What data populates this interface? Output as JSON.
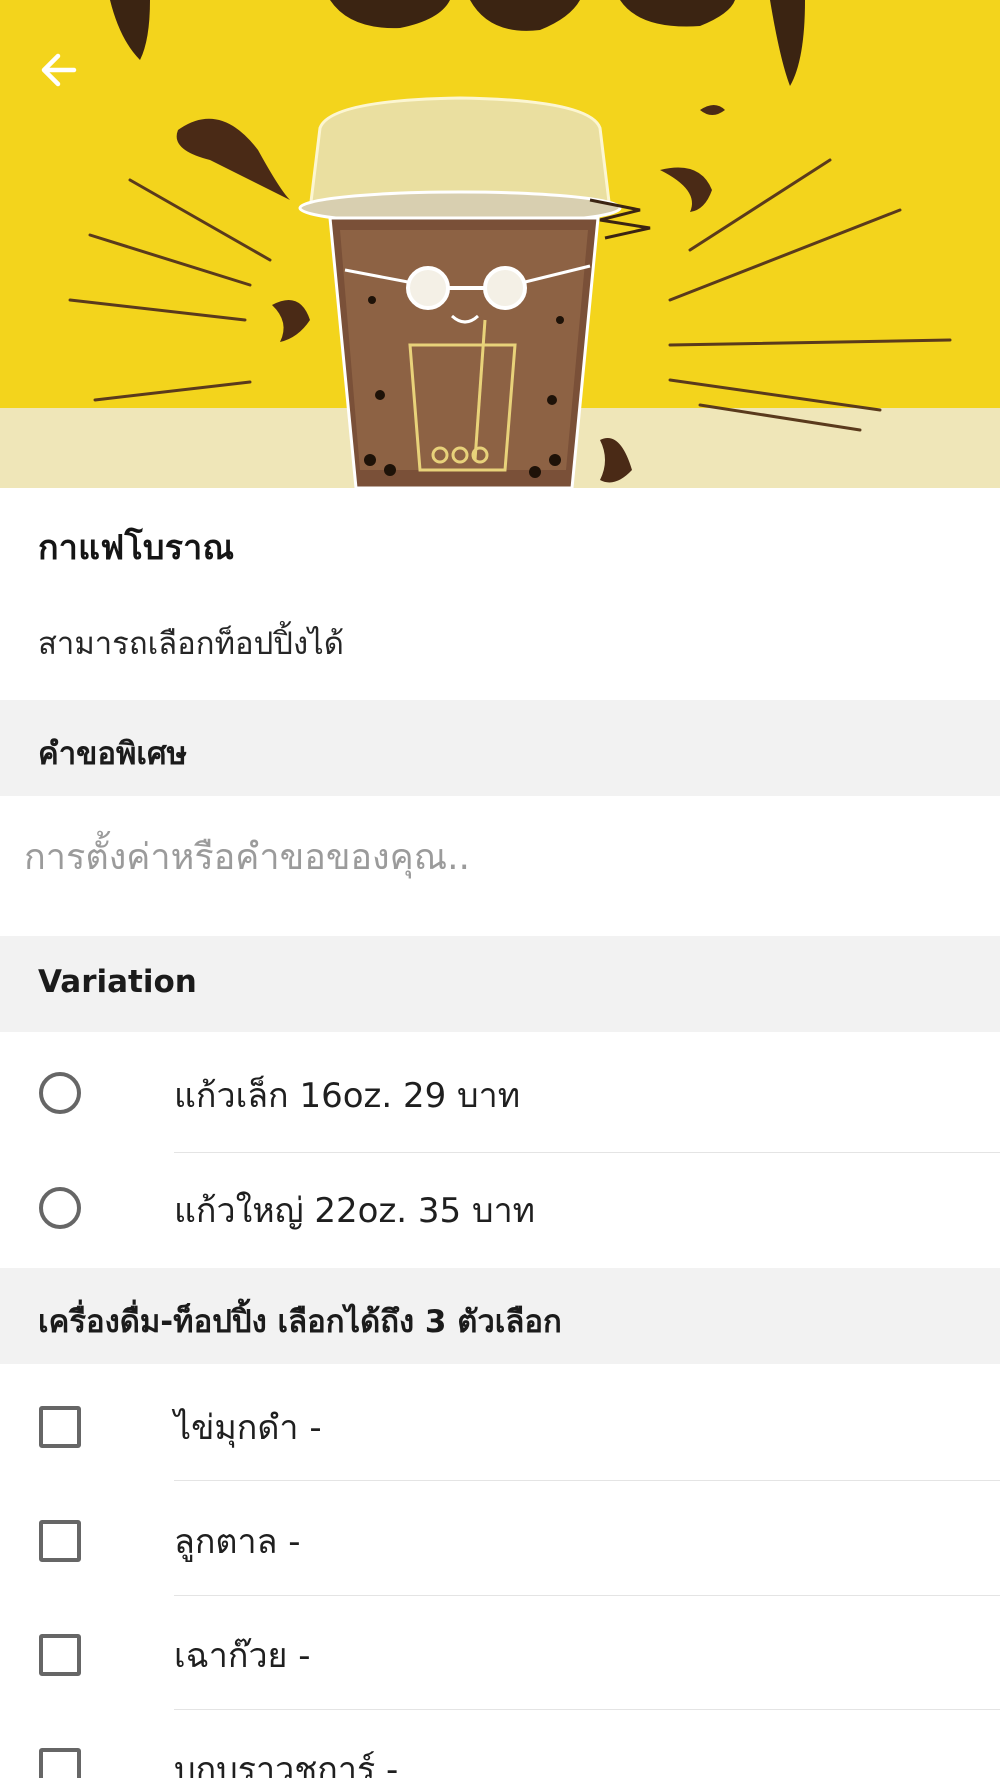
{
  "product": {
    "name": "กาแฟโบราณ",
    "description": "สามารถเลือกท็อปปิ้งได้"
  },
  "special_request": {
    "section_label": "คำขอพิเศษ",
    "placeholder": "การตั้งค่าหรือคำขอของคุณ.."
  },
  "variation": {
    "section_label": "Variation",
    "options": [
      {
        "label": "แก้วเล็ก 16oz. 29 บาท"
      },
      {
        "label": "แก้วใหญ่ 22oz. 35 บาท"
      }
    ]
  },
  "toppings": {
    "section_label": "เครื่องดื่ม-ท็อปปิ้ง เลือกได้ถึง 3 ตัวเลือก",
    "options": [
      {
        "label": "ไข่มุกดำ  -"
      },
      {
        "label": "ลูกตาล  -"
      },
      {
        "label": "เฉาก๊วย  -"
      },
      {
        "label": "บุกบราวชูการ์  -"
      }
    ]
  },
  "icons": {
    "back": "arrow-left-icon",
    "radio": "radio-unchecked-icon",
    "checkbox": "checkbox-unchecked-icon"
  },
  "colors": {
    "hero_background": "#f3d10f",
    "section_background": "#f2f2f2",
    "control_border": "#666666",
    "placeholder_text": "#9b9b9b"
  }
}
